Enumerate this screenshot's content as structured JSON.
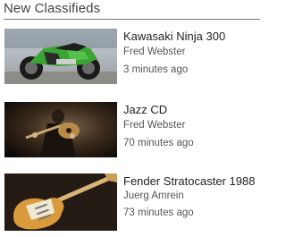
{
  "widget": {
    "title": "New Classifieds"
  },
  "items": [
    {
      "title": "Kawasaki Ninja 300",
      "seller": "Fred Webster",
      "posted": "3 minutes ago",
      "thumbnail_icon": "motorcycle-photo"
    },
    {
      "title": "Jazz CD",
      "seller": "Fred Webster",
      "posted": "70 minutes ago",
      "thumbnail_icon": "guitarist-photo"
    },
    {
      "title": "Fender Stratocaster 1988",
      "seller": "Juerg Amrein",
      "posted": "73 minutes ago",
      "thumbnail_icon": "guitar-photo"
    }
  ]
}
